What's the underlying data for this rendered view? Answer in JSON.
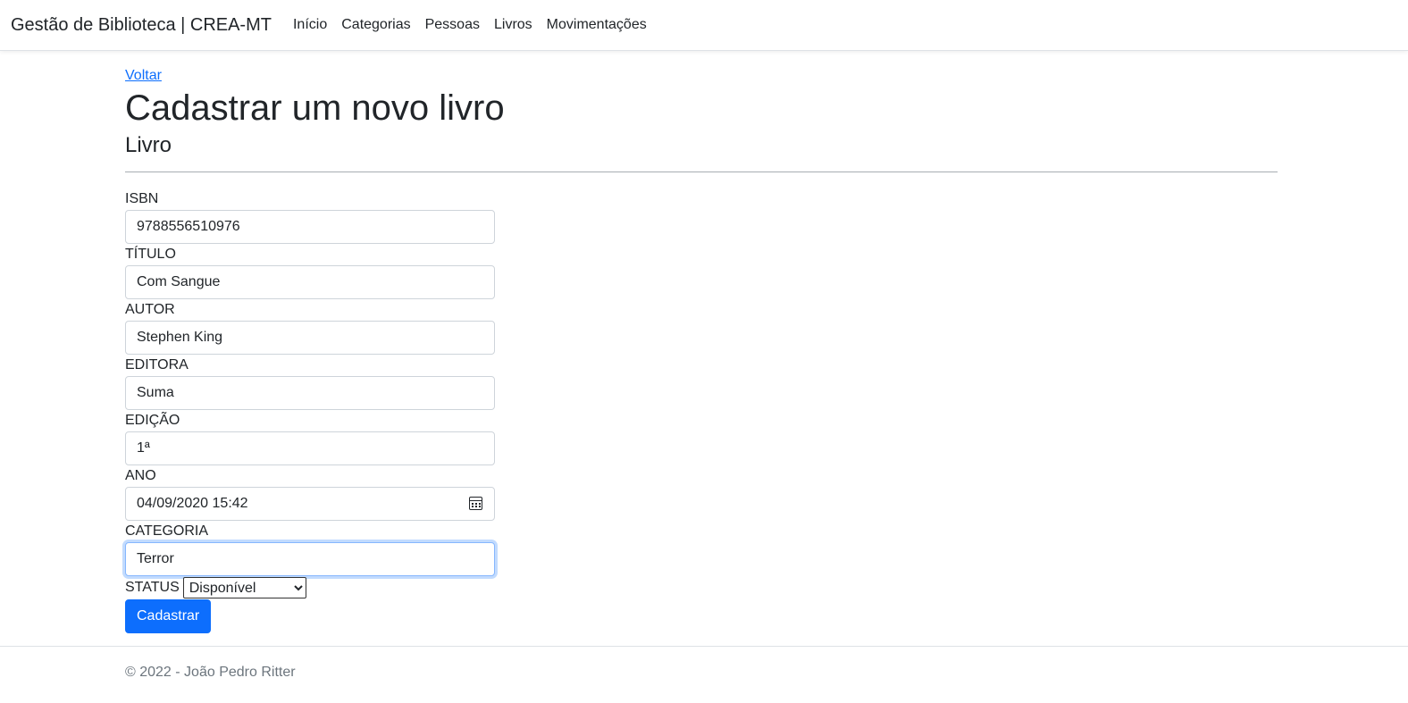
{
  "navbar": {
    "brand": "Gestão de Biblioteca | CREA-MT",
    "links": [
      "Início",
      "Categorias",
      "Pessoas",
      "Livros",
      "Movimentações"
    ]
  },
  "main": {
    "back_label": "Voltar",
    "title": "Cadastrar um novo livro",
    "section": "Livro"
  },
  "form": {
    "isbn": {
      "label": "ISBN",
      "value": "9788556510976"
    },
    "titulo": {
      "label": "TÍTULO",
      "value": "Com Sangue"
    },
    "autor": {
      "label": "AUTOR",
      "value": "Stephen King"
    },
    "editora": {
      "label": "EDITORA",
      "value": "Suma"
    },
    "edicao": {
      "label": "EDIÇÃO",
      "value": "1ª"
    },
    "ano": {
      "label": "ANO",
      "value": "04/09/2020 15:42"
    },
    "categoria": {
      "label": "CATEGORIA",
      "value": "Terror"
    },
    "status": {
      "label": "STATUS",
      "selected": "Disponível"
    },
    "submit_label": "Cadastrar"
  },
  "footer": {
    "text": "© 2022 - João Pedro Ritter"
  },
  "colors": {
    "primary": "#0d6efd",
    "focus_border": "#86b7fe",
    "text": "#212529",
    "muted": "#6c757d"
  }
}
